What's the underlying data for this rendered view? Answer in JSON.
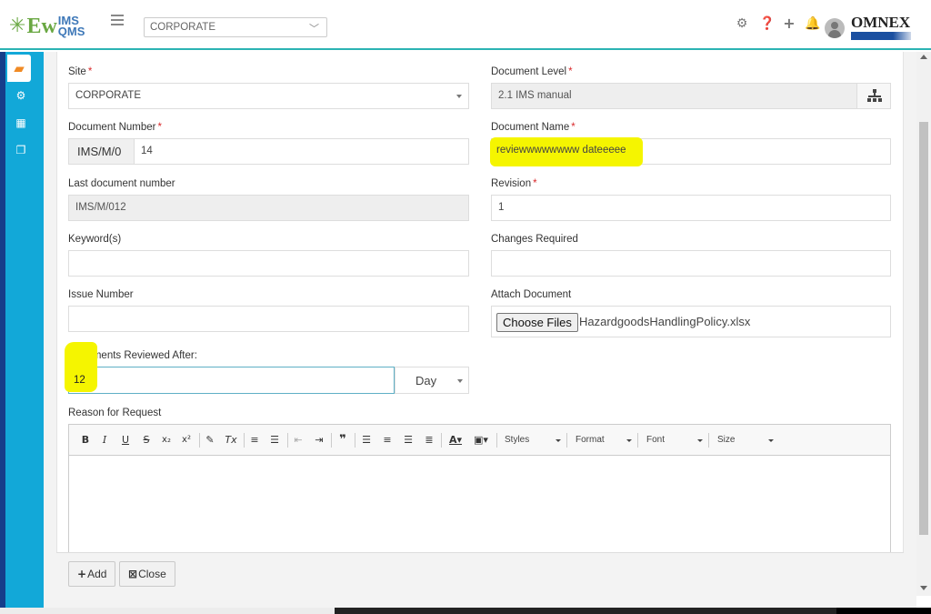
{
  "header": {
    "logo_main": "Ew",
    "logo_ims": "IMS",
    "logo_qms": "QMS",
    "site_selector_value": "CORPORATE",
    "brand": "OMNEX",
    "icons": [
      "gear-icon",
      "help-icon",
      "plus-icon",
      "bell-icon",
      "user-avatar"
    ]
  },
  "sidebar": {
    "items": [
      {
        "name": "documents-icon",
        "active": true
      },
      {
        "name": "settings-gears-icon",
        "active": false
      },
      {
        "name": "building-icon",
        "active": false
      },
      {
        "name": "copy-icon",
        "active": false
      }
    ]
  },
  "form": {
    "site": {
      "label": "Site",
      "required": "*",
      "value": "CORPORATE"
    },
    "document_level": {
      "label": "Document Level",
      "required": "*",
      "value": "2.1 IMS manual"
    },
    "document_number": {
      "label": "Document Number",
      "required": "*",
      "prefix": "IMS/M/0",
      "value": "14"
    },
    "document_name": {
      "label": "Document Name",
      "required": "*",
      "value": "reviewwwwwwww dateeeee"
    },
    "last_document_number": {
      "label": "Last document number",
      "value": "IMS/M/012"
    },
    "revision": {
      "label": "Revision",
      "required": "*",
      "value": "1"
    },
    "keywords": {
      "label": "Keyword(s)",
      "value": ""
    },
    "changes_required": {
      "label": "Changes Required",
      "value": ""
    },
    "issue_number": {
      "label": "Issue Number",
      "value": ""
    },
    "attach_document": {
      "label": "Attach Document",
      "button": "Choose Files",
      "filename": "HazardgoodsHandlingPolicy.xlsx"
    },
    "documents_reviewed_after": {
      "label": "Documents Reviewed After:",
      "value": "12",
      "unit": "Day"
    },
    "reason_for_request": {
      "label": "Reason for Request"
    }
  },
  "editor_toolbar": {
    "bold": "B",
    "italic": "I",
    "underline": "U",
    "strike": "S",
    "subscript": "x₂",
    "superscript": "x²",
    "blockquote": "❞",
    "styles": "Styles",
    "format": "Format",
    "font": "Font",
    "size": "Size"
  },
  "footer": {
    "add_label": "Add",
    "close_label": "Close"
  },
  "colors": {
    "accent_teal": "#2bb3b3",
    "sidebar": "#12a8d8",
    "sidebar_dark": "#163e8a",
    "required": "#d9292b",
    "highlight": "#f5f500"
  }
}
